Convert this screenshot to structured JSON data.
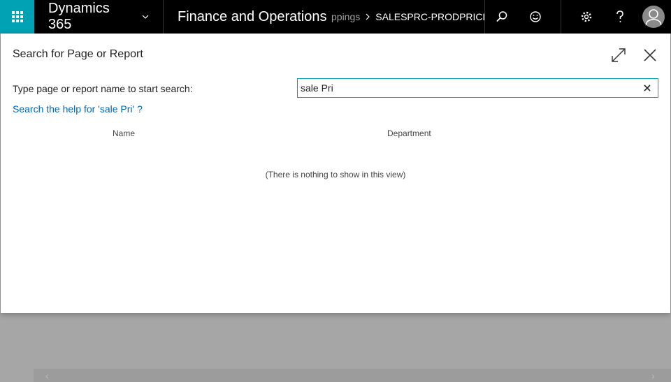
{
  "topbar": {
    "brand": "Dynamics 365",
    "app_title": "Finance and Operations",
    "breadcrumb_prev": "ppings",
    "breadcrumb_current": "SALESPRC-PRODPRICE",
    "icons": [
      "waffle-icon",
      "chevron-down-icon",
      "search-icon",
      "smiley-icon",
      "gear-icon",
      "help-icon",
      "user-avatar-icon"
    ]
  },
  "dialog": {
    "title": "Search for Page or Report",
    "field_label": "Type page or report name to start search:",
    "search_value": "sale Pri",
    "help_link": "Search the help for 'sale Pri' ?",
    "columns": {
      "name": "Name",
      "department": "Department"
    },
    "empty_message": "(There is nothing to show in this view)"
  },
  "colors": {
    "accent": "#00a2b4",
    "topbar_bg": "#000000",
    "link": "#0066b4",
    "overlay": "#a6a6a6"
  }
}
